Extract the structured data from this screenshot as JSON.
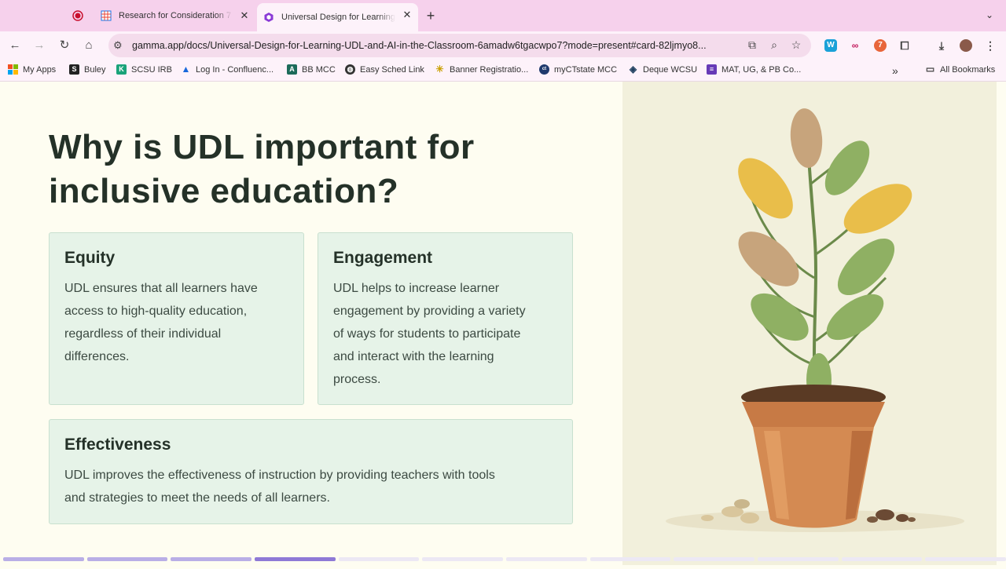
{
  "browser": {
    "tabs": [
      {
        "title": "",
        "favicon": "record-icon"
      },
      {
        "title": "Research for Consideration 7",
        "favicon": "sheets-icon"
      },
      {
        "title": "Universal Design for Learning",
        "favicon": "gamma-icon",
        "active": true
      }
    ],
    "url": "gamma.app/docs/Universal-Design-for-Learning-UDL-and-AI-in-the-Classroom-6amadw6tgacwpo7?mode=present#card-82ljmyo8...",
    "bookmarks": [
      {
        "label": "My Apps",
        "icon": "grid-icon"
      },
      {
        "label": "Buley",
        "icon": "s-icon"
      },
      {
        "label": "SCSU IRB",
        "icon": "k-icon"
      },
      {
        "label": "Log In - Confluenc...",
        "icon": "confluence-icon"
      },
      {
        "label": "BB MCC",
        "icon": "a-icon"
      },
      {
        "label": "Easy Sched Link",
        "icon": "globe-icon"
      },
      {
        "label": "Banner Registratio...",
        "icon": "sparkle-icon"
      },
      {
        "label": "myCTstate MCC",
        "icon": "myct-icon"
      },
      {
        "label": "Deque WCSU",
        "icon": "deque-icon"
      },
      {
        "label": "MAT, UG, & PB Co...",
        "icon": "forms-icon"
      }
    ],
    "all_bookmarks": "All Bookmarks"
  },
  "slide": {
    "title_line1": "Why is UDL important for",
    "title_line2": "inclusive education?",
    "cards": [
      {
        "heading": "Equity",
        "lines": [
          "UDL ensures that all learners have",
          "access to high-quality education,",
          "regardless of their individual",
          "differences."
        ]
      },
      {
        "heading": "Engagement",
        "lines": [
          "UDL helps to increase learner",
          "engagement by providing a variety",
          "of ways for students to participate",
          "and interact with the learning",
          "process."
        ]
      },
      {
        "heading": "Effectiveness",
        "lines": [
          "UDL improves the effectiveness of instruction by providing teachers with tools",
          "and strategies to meet the needs of all learners."
        ]
      }
    ],
    "image": "potted-plant-illustration"
  },
  "colors": {
    "tabbar": "#f6d1ec",
    "card_bg": "#e6f3e8",
    "heading": "#243128",
    "progress_active": "#8e79d6"
  },
  "presentation_progress": {
    "active_card": 4,
    "total_cards": 12
  }
}
